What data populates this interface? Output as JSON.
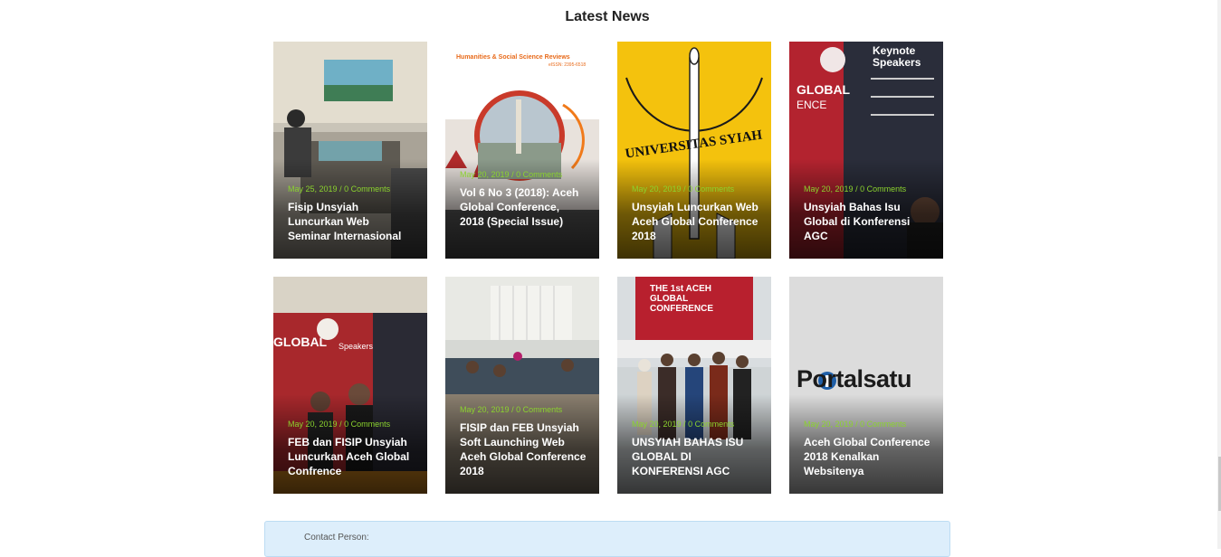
{
  "section_title": "Latest News",
  "cards": [
    {
      "date": "May 25, 2019",
      "comments": "0 Comments",
      "title": "Fisip Unsyiah Luncurkan Web Seminar Internasional",
      "image": "seminar-room-photo"
    },
    {
      "date": "May 20, 2019",
      "comments": "0 Comments",
      "title": "Vol 6 No 3 (2018): Aceh Global Conference, 2018 (Special Issue)",
      "image": "journal-cover",
      "cover_header": "Humanities & Social Science Reviews",
      "cover_issn": "eISSN: 2395-6518"
    },
    {
      "date": "May 20, 2019",
      "comments": "0 Comments",
      "title": "Unsyiah Luncurkan Web Aceh Global Conference 2018",
      "image": "unsyiah-logo",
      "logo_text": "UNIVERSITAS SYIAH KUALA"
    },
    {
      "date": "May 20, 2019",
      "comments": "0 Comments",
      "title": "Unsyiah Bahas Isu Global di Konferensi AGC",
      "image": "keynote-banner-photo",
      "banner_text": "Keynote Speakers"
    },
    {
      "date": "May 20, 2019",
      "comments": "0 Comments",
      "title": "FEB dan FISIP Unsyiah Luncurkan Aceh Global Confrence",
      "image": "conference-backdrop-photo",
      "banner_text": "GLOBAL"
    },
    {
      "date": "May 20, 2019",
      "comments": "0 Comments",
      "title": "FISIP dan FEB Unsyiah Soft Launching Web Aceh Global Conference 2018",
      "image": "meeting-room-photo"
    },
    {
      "date": "May 20, 2019",
      "comments": "0 Comments",
      "title": "UNSYIAH BAHAS ISU GLOBAL DI KONFERENSI AGC",
      "image": "group-photo",
      "banner_text": "THE 1st ACEH GLOBAL CONFERENCE"
    },
    {
      "date": "May 20, 2019",
      "comments": "0 Comments",
      "title": "Aceh Global Conference 2018 Kenalkan Websitenya",
      "image": "portalsatu-logo",
      "logo_text": "Portalsatu"
    }
  ],
  "contact": {
    "label": "Contact Person:"
  },
  "colors": {
    "meta_green": "#8bd32e",
    "contact_bg": "#ddeefb"
  }
}
